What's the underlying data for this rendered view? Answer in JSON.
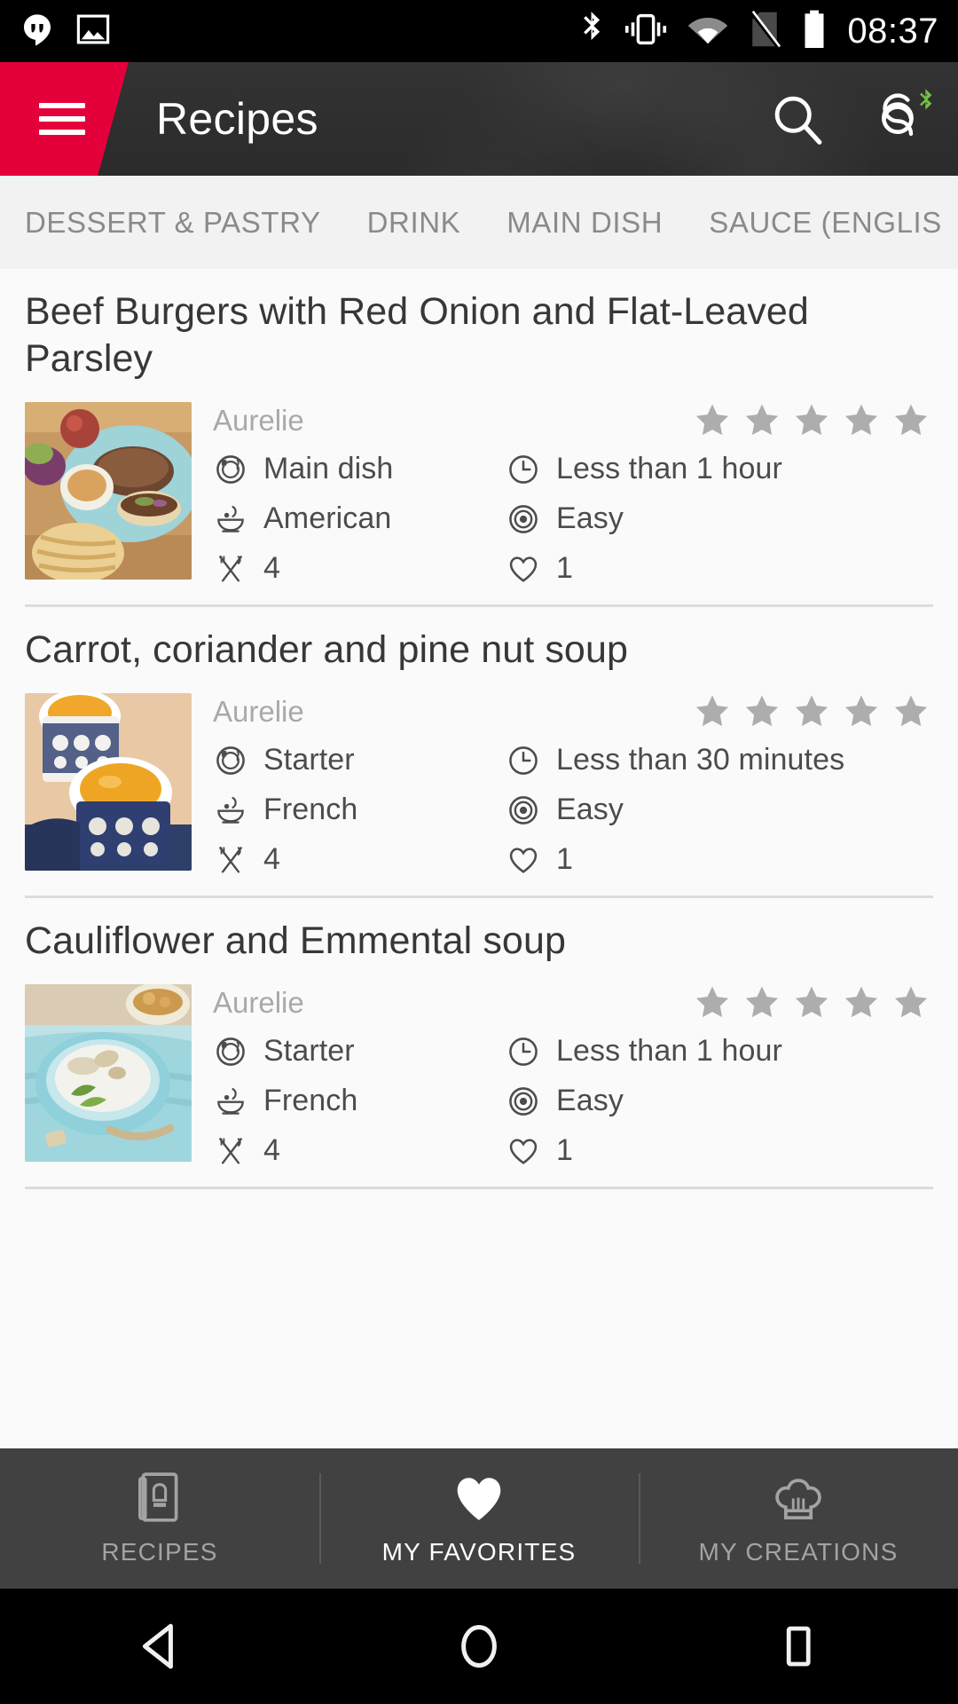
{
  "status_bar": {
    "time": "08:37",
    "left_icons": [
      "hangouts-icon",
      "screenshot-image-icon"
    ],
    "right_icons": [
      "bluetooth-icon",
      "vibrate-icon",
      "wifi-icon",
      "no-sim-icon",
      "battery-icon"
    ]
  },
  "app_bar": {
    "title": "Recipes",
    "menu_icon": "hamburger-menu-icon",
    "search_icon": "search-icon",
    "connect_icon": "cookeo-connect-icon",
    "bluetooth_badge_color": "#76c043",
    "accent_color": "#e4003a"
  },
  "tabs": {
    "items": [
      {
        "label": "DESSERT & PASTRY"
      },
      {
        "label": "DRINK"
      },
      {
        "label": "MAIN DISH"
      },
      {
        "label": "SAUCE (ENGLIS"
      }
    ]
  },
  "recipes": [
    {
      "title": "Beef Burgers with Red Onion and Flat-Leaved Parsley",
      "author": "Aurelie",
      "rating": 0,
      "stars_total": 5,
      "course": "Main dish",
      "cuisine": "American",
      "servings": "4",
      "time": "Less than 1 hour",
      "difficulty": "Easy",
      "likes": "1"
    },
    {
      "title": "Carrot, coriander and pine nut soup",
      "author": "Aurelie",
      "rating": 0,
      "stars_total": 5,
      "course": "Starter",
      "cuisine": "French",
      "servings": "4",
      "time": "Less than 30 minutes",
      "difficulty": "Easy",
      "likes": "1"
    },
    {
      "title": "Cauliflower and Emmental soup",
      "author": "Aurelie",
      "rating": 0,
      "stars_total": 5,
      "course": "Starter",
      "cuisine": "French",
      "servings": "4",
      "time": "Less than 1 hour",
      "difficulty": "Easy",
      "likes": "1"
    }
  ],
  "meta_icons": {
    "course": "plate-cutlery-icon",
    "cuisine": "bowl-icon",
    "servings": "crossed-fork-knife-icon",
    "time": "clock-icon",
    "difficulty": "target-icon",
    "likes": "heart-outline-icon"
  },
  "bottom_nav": {
    "items": [
      {
        "label": "RECIPES",
        "icon": "recipe-book-icon",
        "active": false
      },
      {
        "label": "MY FAVORITES",
        "icon": "heart-filled-icon",
        "active": true
      },
      {
        "label": "MY CREATIONS",
        "icon": "chef-hat-icon",
        "active": false
      }
    ]
  },
  "android_nav": {
    "back": "back-triangle-icon",
    "home": "home-circle-icon",
    "recents": "recents-square-icon"
  }
}
